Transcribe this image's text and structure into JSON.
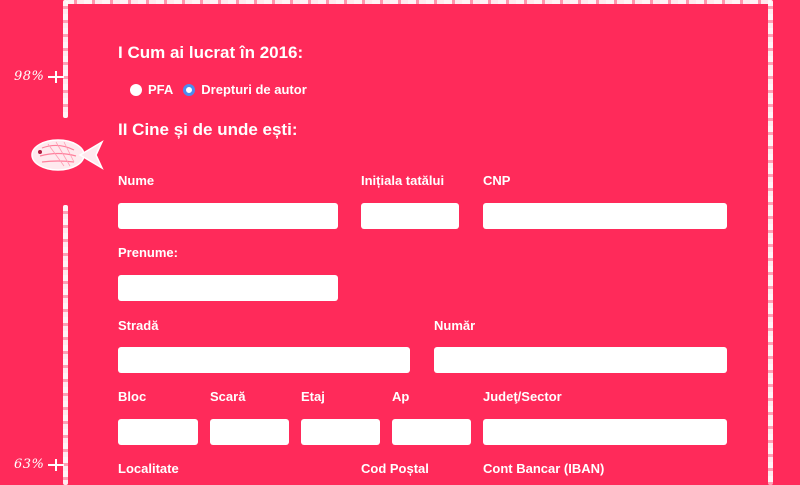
{
  "progress": {
    "top_label": "98%",
    "bottom_label": "63%"
  },
  "section1": {
    "title": "I Cum ai lucrat în 2016:",
    "options": [
      {
        "label": "PFA",
        "selected": false
      },
      {
        "label": "Drepturi de autor",
        "selected": true
      }
    ]
  },
  "section2": {
    "title": "II Cine și de unde ești:",
    "labels": {
      "nume": "Nume",
      "initiala": "Inițiala tatălui",
      "cnp": "CNP",
      "prenume": "Prenume:",
      "strada": "Stradă",
      "numar": "Număr",
      "bloc": "Bloc",
      "scara": "Scară",
      "etaj": "Etaj",
      "ap": "Ap",
      "judet": "Judeţ/Sector",
      "localitate": "Localitate",
      "cod_postal": "Cod Poștal",
      "iban": "Cont Bancar (IBAN)"
    }
  },
  "icons": {
    "fish": "fish-icon"
  },
  "colors": {
    "background": "#ff2a5a",
    "input": "#ffffff",
    "radio_accent": "#4a8df0"
  }
}
